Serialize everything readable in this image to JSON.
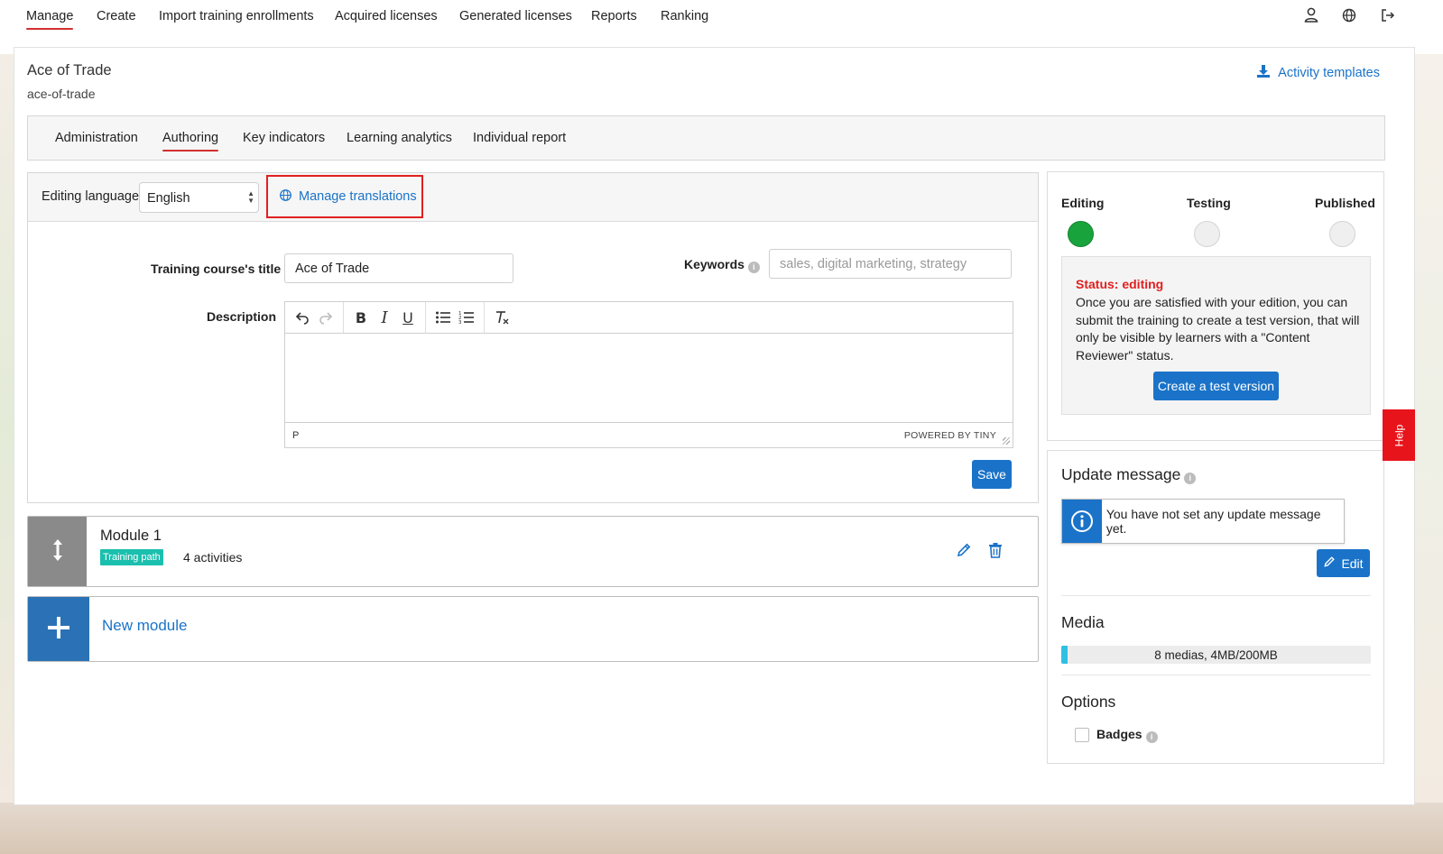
{
  "topnav": {
    "items": [
      "Manage",
      "Create",
      "Import training enrollments",
      "Acquired licenses",
      "Generated licenses",
      "Reports",
      "Ranking"
    ],
    "active": "Manage",
    "icons": [
      "user-icon",
      "globe-icon",
      "logout-icon"
    ]
  },
  "course": {
    "title": "Ace of Trade",
    "slug": "ace-of-trade",
    "activity_templates_label": "Activity templates"
  },
  "subtabs": {
    "items": [
      "Administration",
      "Authoring",
      "Key indicators",
      "Learning analytics",
      "Individual report"
    ],
    "active": "Authoring"
  },
  "editor": {
    "language_label": "Editing language:",
    "language_value": "English",
    "manage_translations_label": "Manage translations",
    "title_label": "Training course's title",
    "title_value": "Ace of Trade",
    "keywords_label": "Keywords",
    "keywords_placeholder": "sales, digital marketing, strategy",
    "description_label": "Description",
    "description_value": "",
    "rte_path": "P",
    "rte_powered": "POWERED BY TINY",
    "save_label": "Save"
  },
  "modules": [
    {
      "title": "Module 1",
      "tag": "Training path",
      "activities": "4 activities"
    }
  ],
  "new_module_label": "New module",
  "workflow": {
    "steps": [
      "Editing",
      "Testing",
      "Published"
    ],
    "current": "Editing",
    "status_title": "Status: editing",
    "status_text": "Once you are satisfied with your edition, you can submit the training to create a test version, that will only be visible by learners with a \"Content Reviewer\" status.",
    "create_test_label": "Create a test version"
  },
  "update_message": {
    "heading": "Update message",
    "notice": "You have not set any update message yet.",
    "edit_label": "Edit"
  },
  "media": {
    "heading": "Media",
    "usage_text": "8 medias, 4MB/200MB",
    "usage_fraction": 0.02
  },
  "options": {
    "heading": "Options",
    "badges_label": "Badges",
    "badges_checked": false
  },
  "help_label": "Help",
  "colors": {
    "accent_blue": "#1a73c8",
    "active_underline": "#d32f2f",
    "status_red": "#e02020",
    "editing_green": "#18a33d",
    "tag_teal": "#1bbfae",
    "help_red": "#e8141b"
  }
}
